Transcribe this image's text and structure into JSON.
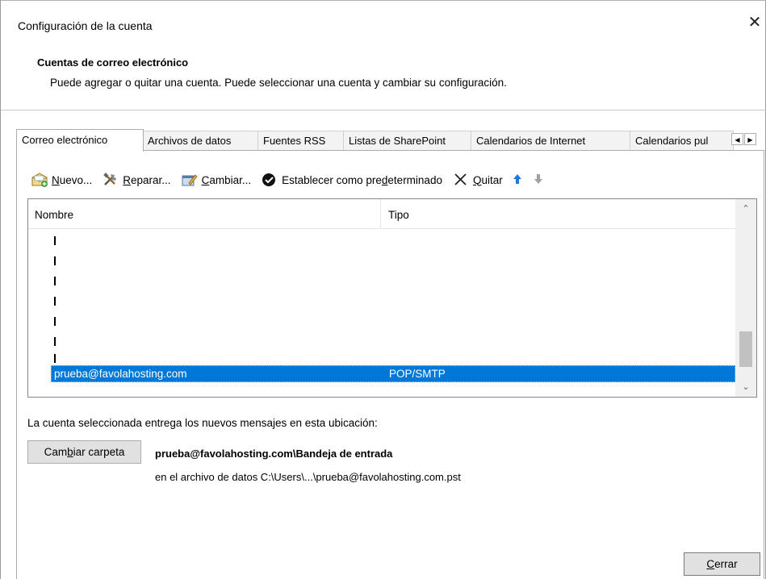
{
  "window": {
    "title": "Configuración de la cuenta",
    "close_glyph": "✕"
  },
  "header": {
    "title": "Cuentas de correo electrónico",
    "description": "Puede agregar o quitar una cuenta. Puede seleccionar una cuenta y cambiar su configuración."
  },
  "tabs": [
    "Correo electrónico",
    "Archivos de datos",
    "Fuentes RSS",
    "Listas de SharePoint",
    "Calendarios de Internet",
    "Calendarios pul"
  ],
  "toolbar": {
    "new": {
      "pre": "",
      "key": "N",
      "post": "uevo...",
      "icon": "new-account-icon"
    },
    "repair": {
      "pre": "",
      "key": "R",
      "post": "eparar...",
      "icon": "repair-tools-icon"
    },
    "change": {
      "pre": "",
      "key": "C",
      "post": "ambiar...",
      "icon": "change-account-icon"
    },
    "set_default": {
      "pre": "Establecer como pre",
      "key": "d",
      "post": "eterminado",
      "icon": "checkmark-circle-icon"
    },
    "remove": {
      "pre": "",
      "key": "Q",
      "post": "uitar",
      "icon": "x-remove-icon"
    }
  },
  "list": {
    "headers": {
      "name": "Nombre",
      "type": "Tipo"
    },
    "selected": {
      "name": "prueba@favolahosting.com",
      "type": "POP/SMTP"
    }
  },
  "delivery": {
    "label": "La cuenta seleccionada entrega los nuevos mensajes en esta ubicación:",
    "change_folder": {
      "pre": "Cam",
      "key": "b",
      "post": "iar carpeta"
    },
    "inbox_path": "prueba@favolahosting.com\\Bandeja de entrada",
    "data_file": "en el archivo de datos C:\\Users\\...\\prueba@favolahosting.com.pst"
  },
  "footer": {
    "close": {
      "pre": "",
      "key": "C",
      "post": "errar"
    }
  },
  "colors": {
    "selection": "#0078d7",
    "arrow_up": "#1e7ae3",
    "arrow_down": "#a0a0a0"
  }
}
